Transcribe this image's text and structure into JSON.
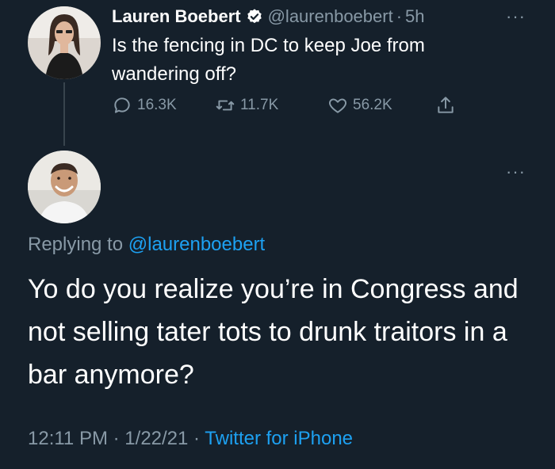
{
  "tweet1": {
    "author_name": "Lauren Boebert",
    "handle": "@laurenboebert",
    "separator": "·",
    "time": "5h",
    "more": "···",
    "text": "Is the fencing in DC to keep Joe from wandering off?",
    "replies": "16.3K",
    "retweets": "11.7K",
    "likes": "56.2K"
  },
  "tweet2": {
    "more": "···",
    "replying_prefix": "Replying to",
    "replying_to": "@laurenboebert",
    "text": "Yo do you realize you’re in Congress and not selling tater tots to drunk traitors in a bar anymore?",
    "time": "12:11 PM",
    "sep1": "·",
    "date": "1/22/21",
    "sep2": "·",
    "source": "Twitter for iPhone"
  },
  "icons": [
    "verified-badge-icon",
    "reply-icon",
    "retweet-icon",
    "like-icon",
    "share-icon",
    "more-icon"
  ],
  "colors": {
    "background": "#15202b",
    "text": "#ffffff",
    "muted": "#8899a6",
    "link": "#1da1f2"
  }
}
